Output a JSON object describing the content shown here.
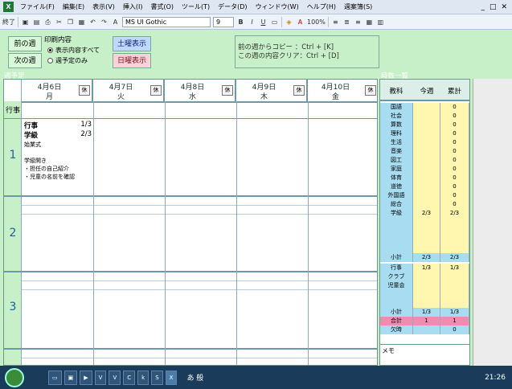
{
  "menubar": {
    "items": [
      "ファイル(F)",
      "編集(E)",
      "表示(V)",
      "挿入(I)",
      "書式(O)",
      "ツール(T)",
      "データ(D)",
      "ウィンドウ(W)",
      "ヘルプ(H)",
      "週案簿(S)"
    ],
    "window_buttons": [
      "_",
      "□",
      "✕"
    ]
  },
  "toolbar": {
    "end_label": "終了",
    "font_name": "MS UI Gothic",
    "font_size": "9",
    "bold": "B",
    "italic": "I",
    "underline": "U",
    "zoom": "100%"
  },
  "controls": {
    "prev_week": "前の週",
    "next_week": "次の週",
    "print_group_title": "印刷内容",
    "print_option_all": "表示内容すべて",
    "print_option_plan": "週予定のみ",
    "show_saturday": "土曜表示",
    "show_sunday": "日曜表示",
    "hint_line1": "前の週からコピー ：Ctrl + [K]",
    "hint_line2": "この週の内容クリア：Ctrl + [D]"
  },
  "week": {
    "section_label": "週予定",
    "holiday_label": "休",
    "days": [
      {
        "date": "4月6日",
        "dow": "月"
      },
      {
        "date": "4月7日",
        "dow": "火"
      },
      {
        "date": "4月8日",
        "dow": "水"
      },
      {
        "date": "4月9日",
        "dow": "木"
      },
      {
        "date": "4月10日",
        "dow": "金"
      }
    ],
    "event_row_label": "行事",
    "periods": [
      "1",
      "2",
      "3"
    ],
    "monday_p1": {
      "subject1": "行事",
      "count1": "1/3",
      "subject2": "学級",
      "count2": "2/3",
      "line1": "始業式",
      "line2": "学級開き",
      "line3": "・担任の自己紹介",
      "line4": "・児童の名前を確認"
    }
  },
  "hours": {
    "section_label": "時数一覧",
    "headers": [
      "教科",
      "今週",
      "累計"
    ],
    "subjects": [
      {
        "name": "国語",
        "week": "",
        "total": "0"
      },
      {
        "name": "社会",
        "week": "",
        "total": "0"
      },
      {
        "name": "算数",
        "week": "",
        "total": "0"
      },
      {
        "name": "理科",
        "week": "",
        "total": "0"
      },
      {
        "name": "生活",
        "week": "",
        "total": "0"
      },
      {
        "name": "音楽",
        "week": "",
        "total": "0"
      },
      {
        "name": "図工",
        "week": "",
        "total": "0"
      },
      {
        "name": "家庭",
        "week": "",
        "total": "0"
      },
      {
        "name": "体育",
        "week": "",
        "total": "0"
      },
      {
        "name": "道徳",
        "week": "",
        "total": "0"
      },
      {
        "name": "外国語",
        "week": "",
        "total": "0"
      },
      {
        "name": "総合",
        "week": "",
        "total": "0"
      },
      {
        "name": "学級",
        "week": "2/3",
        "total": "2/3"
      }
    ],
    "subtotal1": {
      "label": "小計",
      "week": "2/3",
      "total": "2/3"
    },
    "extras": [
      {
        "name": "行事",
        "week": "1/3",
        "total": "1/3"
      },
      {
        "name": "クラブ",
        "week": "",
        "total": ""
      },
      {
        "name": "児童会",
        "week": "",
        "total": ""
      }
    ],
    "subtotal2": {
      "label": "小計",
      "week": "1/3",
      "total": "1/3"
    },
    "grand_total": {
      "label": "合計",
      "week": "1",
      "total": "1"
    },
    "absent": {
      "label": "欠時",
      "week": "",
      "total": "0"
    },
    "memo_label": "メモ"
  },
  "taskbar": {
    "items": [
      "V",
      "V",
      "C",
      "k",
      "S",
      "X"
    ],
    "ime": "あ 般",
    "clock": "21:26"
  }
}
